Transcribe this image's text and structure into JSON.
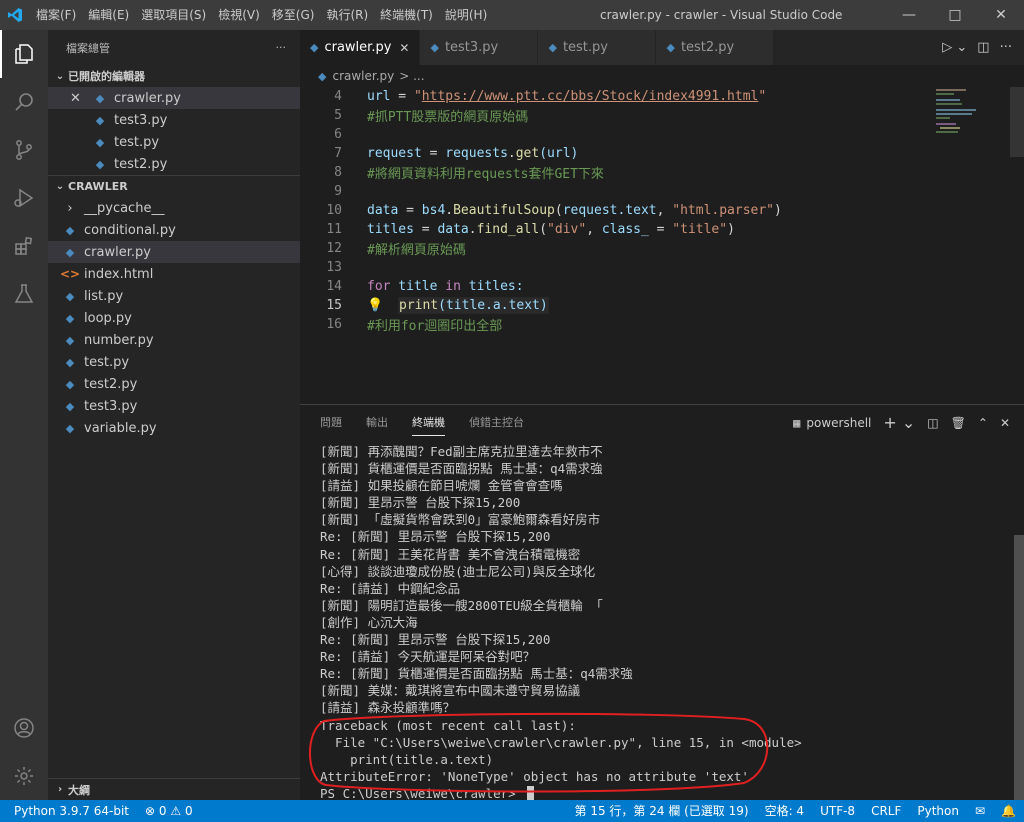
{
  "titlebar": {
    "menus": [
      "檔案(F)",
      "編輯(E)",
      "選取項目(S)",
      "檢視(V)",
      "移至(G)",
      "執行(R)",
      "終端機(T)",
      "說明(H)"
    ],
    "window_title": "crawler.py - crawler - Visual Studio Code"
  },
  "sidebar": {
    "header": "檔案總管",
    "open_editors_title": "已開啟的編輯器",
    "open_editors": [
      "crawler.py",
      "test3.py",
      "test.py",
      "test2.py"
    ],
    "folder_title": "CRAWLER",
    "files": [
      {
        "name": "__pycache__",
        "type": "folder"
      },
      {
        "name": "conditional.py",
        "type": "py"
      },
      {
        "name": "crawler.py",
        "type": "py"
      },
      {
        "name": "index.html",
        "type": "html"
      },
      {
        "name": "list.py",
        "type": "py"
      },
      {
        "name": "loop.py",
        "type": "py"
      },
      {
        "name": "number.py",
        "type": "py"
      },
      {
        "name": "test.py",
        "type": "py"
      },
      {
        "name": "test2.py",
        "type": "py"
      },
      {
        "name": "test3.py",
        "type": "py"
      },
      {
        "name": "variable.py",
        "type": "py"
      }
    ],
    "outline_title": "大綱"
  },
  "editor": {
    "tabs": [
      "crawler.py",
      "test3.py",
      "test.py",
      "test2.py"
    ],
    "breadcrumb_file": "crawler.py",
    "breadcrumb_rest": "> ...",
    "line_numbers": [
      "4",
      "5",
      "6",
      "7",
      "8",
      "9",
      "10",
      "11",
      "12",
      "13",
      "14",
      "15",
      "16"
    ],
    "code": {
      "l4_var": "url",
      "l4_op": " = ",
      "l4_q1": "\"",
      "l4_url": "https://www.ptt.cc/bbs/Stock/index4991.html",
      "l4_q2": "\"",
      "l5": "#抓PTT股票版的網頁原始碼",
      "l7_var": "request",
      "l7_op": " = ",
      "l7_mod": "requests",
      "l7_dot": ".",
      "l7_fn": "get",
      "l7_arg": "(url)",
      "l8": "#將網頁資料利用requests套件GET下來",
      "l10_var": "data",
      "l10_op": " = ",
      "l10_mod": "bs4",
      "l10_dot": ".",
      "l10_fn": "BeautifulSoup",
      "l10_open": "(",
      "l10_a1": "request.text",
      "l10_comma": ", ",
      "l10_str": "\"html.parser\"",
      "l10_close": ")",
      "l11_var": "titles",
      "l11_op": " = ",
      "l11_mod": "data",
      "l11_dot": ".",
      "l11_fn": "find_all",
      "l11_open": "(",
      "l11_s1": "\"div\"",
      "l11_comma": ", ",
      "l11_kw": "class_",
      "l11_eq": " = ",
      "l11_s2": "\"title\"",
      "l11_close": ")",
      "l12": "#解析網頁原始碼",
      "l14_for": "for",
      "l14_var": " title ",
      "l14_in": "in",
      "l14_rest": " titles:",
      "l15_fn": "print",
      "l15_arg": "(title.a.text)",
      "l16": "#利用for迴圈印出全部"
    }
  },
  "panel": {
    "tabs": [
      "問題",
      "輸出",
      "終端機",
      "偵錯主控台"
    ],
    "shell": "powershell",
    "terminal_lines": [
      "[新聞] 再添醜聞？Fed副主席克拉里達去年救市不",
      "[新聞] 貨櫃運價是否面臨拐點 馬士基：q4需求強",
      "[請益] 如果投顧在節目唬爛 金管會會查嗎",
      "[新聞] 里昂示警 台股下探15,200",
      "[新聞] 「虛擬貨幣會跌到0」富豪鮑爾森看好房市",
      "Re: [新聞] 里昂示警 台股下探15,200",
      "Re: [新聞] 王美花背書 美不會洩台積電機密",
      "[心得] 談談迪瓊成份股(迪士尼公司)與反全球化",
      "Re: [請益] 中鋼紀念品",
      "[新聞] 陽明訂造最後一艘2800TEU級全貨櫃輪 「",
      "[創作] 心沉大海",
      "Re: [新聞] 里昂示警 台股下探15,200",
      "Re: [請益] 今天航運是阿呆谷對吧？",
      "Re: [新聞] 貨櫃運價是否面臨拐點 馬士基：q4需求強",
      "[新聞] 美媒：戴琪將宣布中國未遵守貿易協議",
      "[請益] 森永投顧準嗎？",
      "Traceback (most recent call last):",
      "  File \"C:\\Users\\weiwe\\crawler\\crawler.py\", line 15, in <module>",
      "    print(title.a.text)",
      "AttributeError: 'NoneType' object has no attribute 'text'",
      "PS C:\\Users\\weiwe\\crawler> "
    ]
  },
  "statusbar": {
    "python": "Python 3.9.7 64-bit",
    "errors": "0",
    "warnings": "0",
    "position": "第 15 行，第 24 欄 (已選取 19)",
    "spaces": "空格: 4",
    "encoding": "UTF-8",
    "eol": "CRLF",
    "language": "Python"
  },
  "colors": {
    "accent": "#007acc",
    "annotation": "#e02020"
  }
}
